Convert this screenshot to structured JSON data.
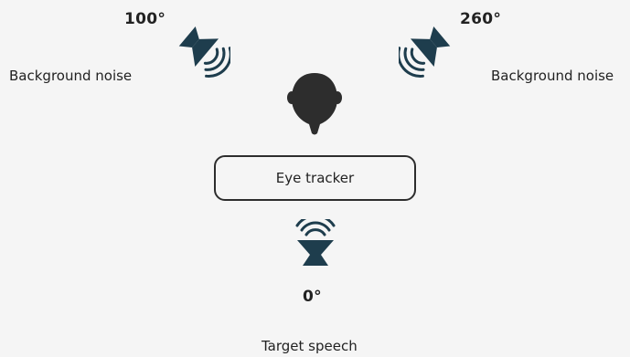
{
  "colors": {
    "icon": "#1e3d4d",
    "head": "#2d2d2d",
    "text": "#222222",
    "background": "#f5f5f5"
  },
  "sources": {
    "left": {
      "angle": "100°",
      "caption": "Background noise",
      "icon": "speaker-icon"
    },
    "right": {
      "angle": "260°",
      "caption": "Background noise",
      "icon": "speaker-icon"
    },
    "bottom": {
      "angle": "0°",
      "caption": "Target speech",
      "icon": "speaker-icon"
    }
  },
  "listener": {
    "icon": "head-icon"
  },
  "device": {
    "label": "Eye tracker"
  }
}
